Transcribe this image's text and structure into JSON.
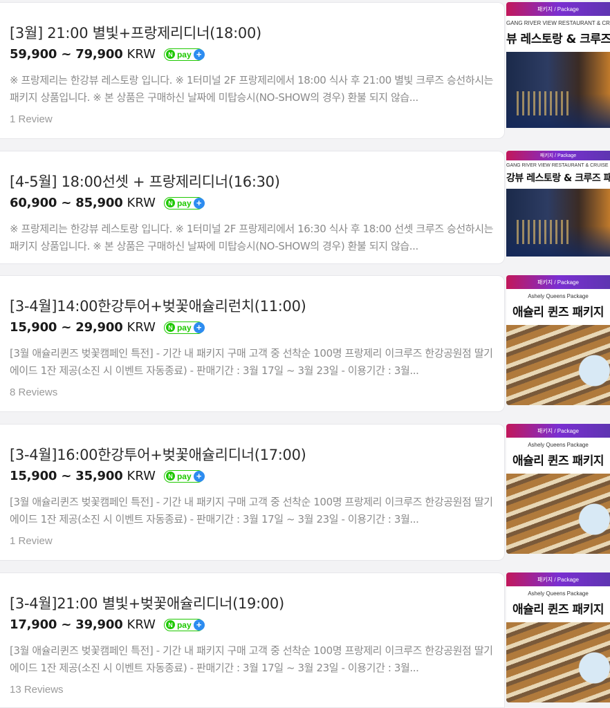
{
  "listings": [
    {
      "title": "[3월] 21:00 별빛+프랑제리디너(18:00)",
      "price": "59,900 ~ 79,900",
      "currency": "KRW",
      "npay": "pay",
      "desc": "※ 프랑제리는 한강뷰 레스토랑 입니다. ※ 1터미널 2F 프랑제리에서 18:00 식사 후 21:00 별빛 크루즈 승선하시는 패키지 상품입니다. ※ 본 상품은 구매하신 날짜에 미탑승시(NO-SHOW의 경우) 환불 되지 않습...",
      "reviews": "1 Review",
      "thumb": {
        "banner": "패키지 / Package",
        "sub": "GANG RIVER VIEW RESTAURANT & CRUISE PA",
        "head": "뷰 레스토랑 & 크루즈 패"
      }
    },
    {
      "title": "[4-5월] 18:00선셋 + 프랑제리디너(16:30)",
      "price": "60,900 ~ 85,900",
      "currency": "KRW",
      "npay": "pay",
      "desc": "※ 프랑제리는 한강뷰 레스토랑 입니다. ※ 1터미널 2F 프랑제리에서 16:30 식사 후 18:00 선셋 크루즈 승선하시는 패키지 상품입니다. ※ 본 상품은 구매하신 날짜에 미탑승시(NO-SHOW의 경우) 환불 되지 않습...",
      "reviews": "",
      "thumb": {
        "banner": "패키지 / Package",
        "sub": "GANG RIVER VIEW RESTAURANT & CRUISE PACK",
        "head": "강뷰 레스토랑 & 크루즈 패키"
      }
    },
    {
      "title": "[3-4월]14:00한강투어+벚꽃애슐리런치(11:00)",
      "price": "15,900 ~ 29,900",
      "currency": "KRW",
      "npay": "pay",
      "desc": "[3월 애슐리퀸즈 벚꽃캠페인 특전] - 기간 내 패키지 구매 고객 중 선착순 100명 프랑제리 이크루즈 한강공원점 딸기 에이드 1잔 제공(소진 시 이벤트 자동종료) - 판매기간 : 3월 17일 ~ 3월 23일 - 이용기간 : 3월...",
      "reviews": "8 Reviews",
      "thumb": {
        "banner": "패키지 / Package",
        "sub": "Ashely Queens Package",
        "head": "애슐리 퀸즈 패키지"
      }
    },
    {
      "title": "[3-4월]16:00한강투어+벚꽃애슐리디너(17:00)",
      "price": "15,900 ~ 35,900",
      "currency": "KRW",
      "npay": "pay",
      "desc": "[3월 애슐리퀸즈 벚꽃캠페인 특전] - 기간 내 패키지 구매 고객 중 선착순 100명 프랑제리 이크루즈 한강공원점 딸기 에이드 1잔 제공(소진 시 이벤트 자동종료) - 판매기간 : 3월 17일 ~ 3월 23일 - 이용기간 : 3월...",
      "reviews": "1 Review",
      "thumb": {
        "banner": "패키지 / Package",
        "sub": "Ashely Queens Package",
        "head": "애슐리 퀸즈 패키지"
      }
    },
    {
      "title": "[3-4월]21:00 별빛+벚꽃애슐리디너(19:00)",
      "price": "17,900 ~ 39,900",
      "currency": "KRW",
      "npay": "pay",
      "desc": "[3월 애슐리퀸즈 벚꽃캠페인 특전] - 기간 내 패키지 구매 고객 중 선착순 100명 프랑제리 이크루즈 한강공원점 딸기 에이드 1잔 제공(소진 시 이벤트 자동종료) - 판매기간 : 3월 17일 ~ 3월 23일 - 이용기간 : 3월...",
      "reviews": "13 Reviews",
      "thumb": {
        "banner": "패키지 / Package",
        "sub": "Ashely Queens Package",
        "head": "애슐리 퀸즈 패키지"
      }
    }
  ],
  "colors": {
    "npay_green": "#1ec800",
    "npay_plus": "#2d8cf0",
    "banner_start": "#c2185b",
    "banner_end": "#5e35b1"
  }
}
